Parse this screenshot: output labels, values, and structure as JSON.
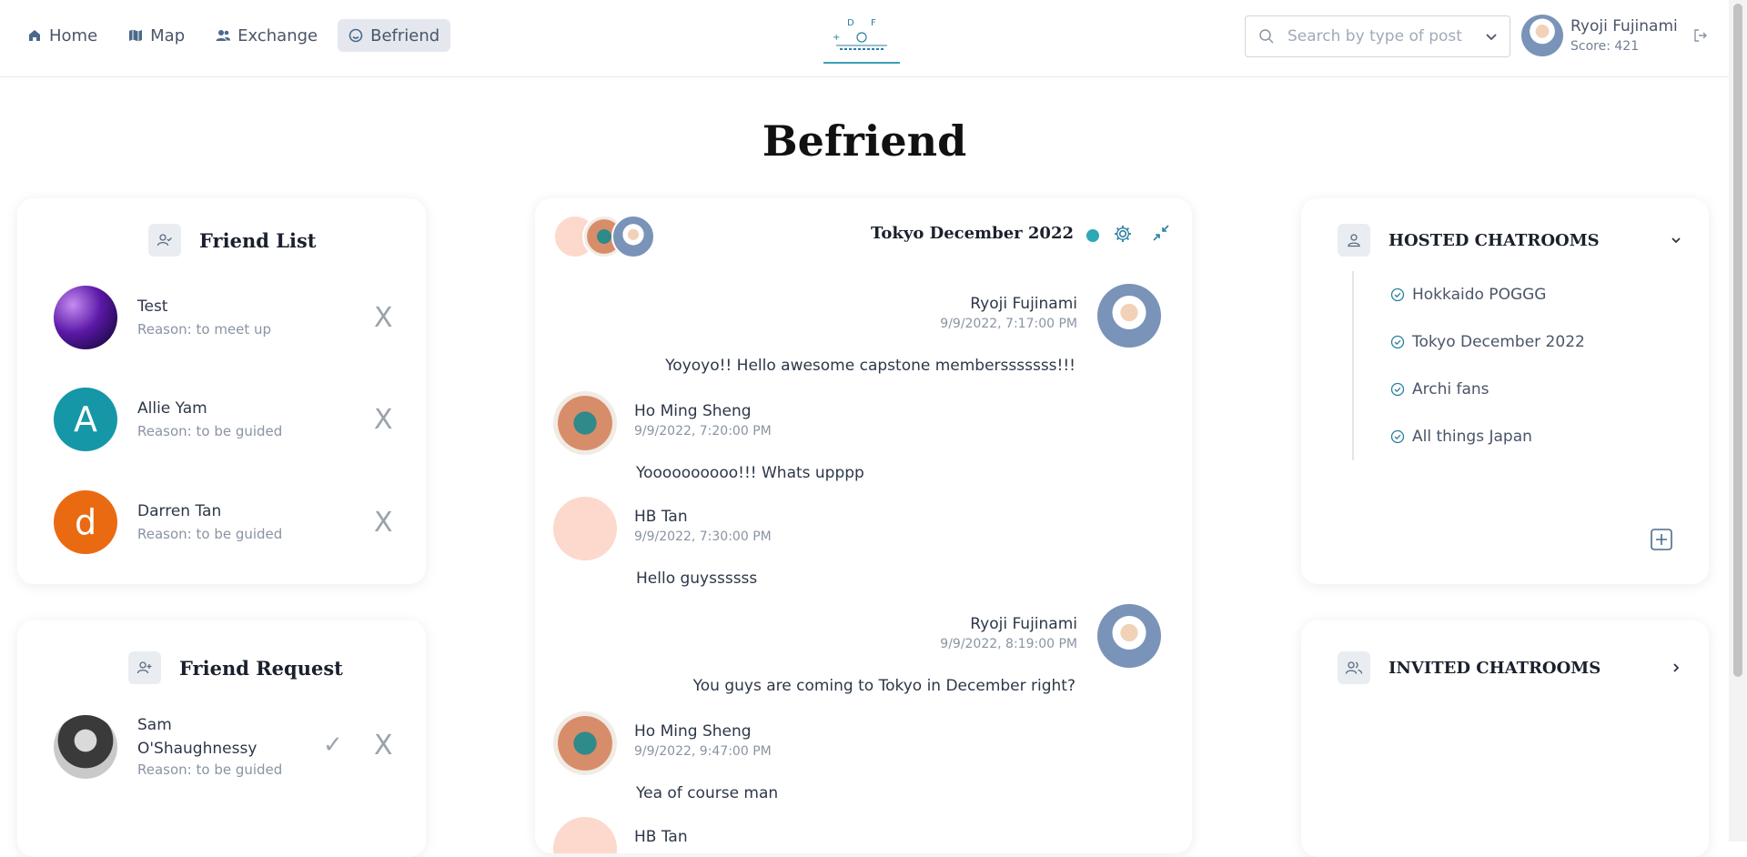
{
  "nav": {
    "items": [
      {
        "label": "Home",
        "icon": "home-icon"
      },
      {
        "label": "Map",
        "icon": "map-icon"
      },
      {
        "label": "Exchange",
        "icon": "users-icon"
      },
      {
        "label": "Befriend",
        "icon": "smile-icon",
        "active": true
      }
    ]
  },
  "search": {
    "placeholder": "Search by type of post"
  },
  "user": {
    "name": "Ryoji Fujinami",
    "score": "Score: 421"
  },
  "page": {
    "title": "Befriend"
  },
  "friend_list": {
    "title": "Friend List",
    "remove_label": "X",
    "friends": [
      {
        "name": "Test",
        "reason": "Reason: to meet up"
      },
      {
        "name": "Allie Yam",
        "reason": "Reason: to be guided",
        "initial": "A",
        "color": "#1597a7"
      },
      {
        "name": "Darren Tan",
        "reason": "Reason: to be guided",
        "initial": "d",
        "color": "#ea6a12"
      }
    ]
  },
  "friend_request": {
    "title": "Friend Request",
    "accept_label": "✓",
    "reject_label": "X",
    "requests": [
      {
        "name_line1": "Sam",
        "name_line2": "O'Shaughnessy",
        "reason": "Reason: to be guided"
      }
    ]
  },
  "chat": {
    "title": "Tokyo December 2022",
    "status_color": "#2fa7b4",
    "messages": [
      {
        "sender": "Ryoji Fujinami",
        "time": "9/9/2022, 7:17:00 PM",
        "text": "Yoyoyo!! Hello awesome capstone membersssssss!!!",
        "self": true
      },
      {
        "sender": "Ho Ming Sheng",
        "time": "9/9/2022, 7:20:00 PM",
        "text": "Yoooooooooo!!! Whats upppp",
        "self": false
      },
      {
        "sender": "HB Tan",
        "time": "9/9/2022, 7:30:00 PM",
        "text": "Hello guyssssss",
        "self": false
      },
      {
        "sender": "Ryoji Fujinami",
        "time": "9/9/2022, 8:19:00 PM",
        "text": "You guys are coming to Tokyo in December right?",
        "self": true
      },
      {
        "sender": "Ho Ming Sheng",
        "time": "9/9/2022, 9:47:00 PM",
        "text": "Yea of course man",
        "self": false
      },
      {
        "sender": "HB Tan",
        "time": "",
        "text": "",
        "self": false
      }
    ]
  },
  "hosted": {
    "title": "HOSTED CHATROOMS",
    "rooms": [
      "Hokkaido POGGG",
      "Tokyo December 2022",
      "Archi fans",
      "All things Japan"
    ]
  },
  "invited": {
    "title": "INVITED CHATROOMS"
  }
}
